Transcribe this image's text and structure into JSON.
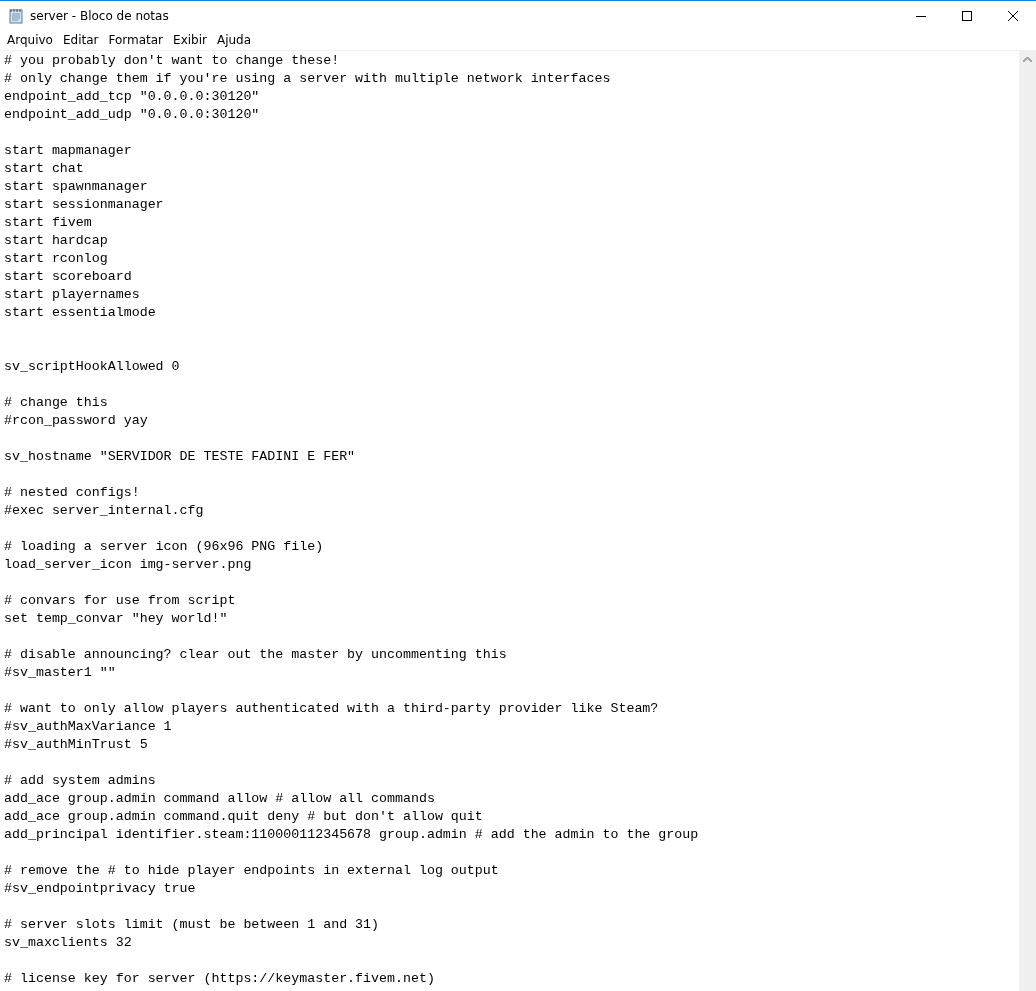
{
  "window": {
    "title": "server - Bloco de notas",
    "controls": [
      {
        "kind": "minimize"
      },
      {
        "kind": "maximize"
      },
      {
        "kind": "close"
      }
    ]
  },
  "menu": [
    "Arquivo",
    "Editar",
    "Formatar",
    "Exibir",
    "Ajuda"
  ],
  "editor": {
    "lines": [
      {
        "kind": "text",
        "text": "# you probably don't want to change these!"
      },
      {
        "kind": "text",
        "text": "# only change them if you're using a server with multiple network interfaces"
      },
      {
        "kind": "text",
        "text": "endpoint_add_tcp \"0.0.0.0:30120\""
      },
      {
        "kind": "text",
        "text": "endpoint_add_udp \"0.0.0.0:30120\""
      },
      {
        "kind": "blank"
      },
      {
        "kind": "text",
        "text": "start mapmanager"
      },
      {
        "kind": "text",
        "text": "start chat"
      },
      {
        "kind": "text",
        "text": "start spawnmanager"
      },
      {
        "kind": "text",
        "text": "start sessionmanager"
      },
      {
        "kind": "text",
        "text": "start fivem"
      },
      {
        "kind": "text",
        "text": "start hardcap"
      },
      {
        "kind": "text",
        "text": "start rconlog"
      },
      {
        "kind": "text",
        "text": "start scoreboard"
      },
      {
        "kind": "text",
        "text": "start playernames"
      },
      {
        "kind": "text",
        "text": "start essentialmode"
      },
      {
        "kind": "blank"
      },
      {
        "kind": "blank"
      },
      {
        "kind": "text",
        "text": "sv_scriptHookAllowed 0"
      },
      {
        "kind": "blank"
      },
      {
        "kind": "text",
        "text": "# change this"
      },
      {
        "kind": "text",
        "text": "#rcon_password yay"
      },
      {
        "kind": "blank"
      },
      {
        "kind": "text",
        "text": "sv_hostname \"SERVIDOR DE TESTE FADINI E FER\""
      },
      {
        "kind": "blank"
      },
      {
        "kind": "text",
        "text": "# nested configs!"
      },
      {
        "kind": "text",
        "text": "#exec server_internal.cfg"
      },
      {
        "kind": "blank"
      },
      {
        "kind": "text",
        "text": "# loading a server icon (96x96 PNG file)"
      },
      {
        "kind": "text",
        "text": "load_server_icon img-server.png"
      },
      {
        "kind": "blank"
      },
      {
        "kind": "text",
        "text": "# convars for use from script"
      },
      {
        "kind": "text",
        "text": "set temp_convar \"hey world!\""
      },
      {
        "kind": "blank"
      },
      {
        "kind": "text",
        "text": "# disable announcing? clear out the master by uncommenting this"
      },
      {
        "kind": "text",
        "text": "#sv_master1 \"\""
      },
      {
        "kind": "blank"
      },
      {
        "kind": "text",
        "text": "# want to only allow players authenticated with a third-party provider like Steam?"
      },
      {
        "kind": "text",
        "text": "#sv_authMaxVariance 1"
      },
      {
        "kind": "text",
        "text": "#sv_authMinTrust 5"
      },
      {
        "kind": "blank"
      },
      {
        "kind": "text",
        "text": "# add system admins"
      },
      {
        "kind": "text",
        "text": "add_ace group.admin command allow # allow all commands"
      },
      {
        "kind": "text",
        "text": "add_ace group.admin command.quit deny # but don't allow quit"
      },
      {
        "kind": "text",
        "text": "add_principal identifier.steam:110000112345678 group.admin # add the admin to the group"
      },
      {
        "kind": "blank"
      },
      {
        "kind": "text",
        "text": "# remove the # to hide player endpoints in external log output"
      },
      {
        "kind": "text",
        "text": "#sv_endpointprivacy true"
      },
      {
        "kind": "blank"
      },
      {
        "kind": "text",
        "text": "# server slots limit (must be between 1 and 31)"
      },
      {
        "kind": "text",
        "text": "sv_maxclients 32"
      },
      {
        "kind": "blank"
      },
      {
        "kind": "text",
        "text": "# license key for server (https://keymaster.fivem.net)"
      }
    ]
  }
}
